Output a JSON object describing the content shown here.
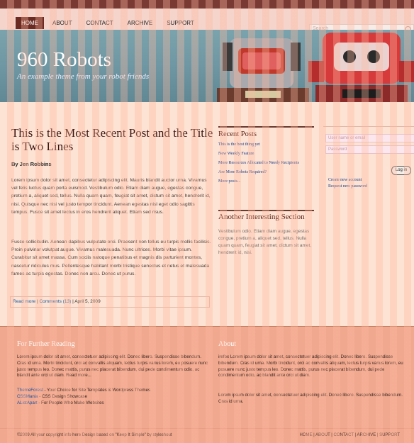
{
  "nav": {
    "items": [
      "HOME",
      "ABOUT",
      "CONTACT",
      "ARCHIVE",
      "SUPPORT"
    ],
    "active": 0,
    "search_placeholder": "Search"
  },
  "banner": {
    "title": "960 Robots",
    "subtitle": "An example theme from your robot friends"
  },
  "post": {
    "title": "This is the Most Recent Post and the Title is Two Lines",
    "byline": "By Jen Robbins",
    "para1": "Lorem ipsum dolor sit amet, consectetur adipiscing elit. Mauris blandit auctor urna. Vivamus vel felis luctus quam porta euismod. Vestibulum odio. Etiam diam augue, egestas congue, pretium a, aliquet sed, tellus. Nulla quam quam, feugiat sit amet, dictum sit amet, hendrerit id, nisi. Quisque nec nisi vel justo tempor tincidunt. Aenean egestas nisl eget odio sagittis tempus. Fusce sit amet lectus in eros hendrerit aliquet. Etiam sed risus.",
    "para2": "Fusce sollicitudin. Aenean dapibus vulputate orci. Praesent non tellus eu turpis mollis facilisis. Proin pulvinar volutpat augue. Vivamus malesuada. Nunc ultrices. Morbi vitae ipsum. Curabitur sit amet massa. Cum sociis natoque penatibus et magnis dis parturient montes, nascetur ridiculus mus. Pellentesque habitant morbi tristique senectus et netus et malesuada fames ac turpis egestas. Donec non arcu. Donec ut purus.",
    "read_more": "Read more",
    "comments": "Comments (13)",
    "date": "April 5, 2009"
  },
  "recent": {
    "heading": "Recent Posts",
    "items": [
      "This is the best thing yet",
      "New Weekly Feature",
      "More Resources Allocated to Needy Recipients",
      "Are More Robots Required?",
      "More posts..."
    ]
  },
  "interest": {
    "heading": "Another Interesting Section",
    "text": "Vestibulum odio. Etiam diam augue, egestas congue, pretium a, aliquet sed, tellus. Nulla quam quam, feugiat sit amet, dictum sit amet, hendrerit id, nisi."
  },
  "login": {
    "user_placeholder": "User name or email",
    "pass_placeholder": "Password",
    "button": "Log in",
    "create": "Create new account",
    "request": "Request new password"
  },
  "footer": {
    "left_heading": "For Further Reading",
    "left_text": "Lorem ipsum dolor sit amet, consectetuer adipiscing elit. Donec libero. Suspendisse bibendum. Cras id urna. Morbi tincidunt, orci ac convallis aliquam, lectus turpis varius lorem, eu posuere nunc justo tempus leo. Donec mattis, purus nec placerat bibendum, dui pede condimentum odio, ac blandit ante orci ut diam. Read more...",
    "links": [
      {
        "name": "ThemeForest",
        "desc": " - Your Choice for Site Templates & Wordpress Themes"
      },
      {
        "name": "CSSMania",
        "desc": " - CSS Design Showcase"
      },
      {
        "name": "AListApart",
        "desc": " - For People Who Make Websites"
      }
    ],
    "right_heading": "About",
    "right_text1": "irefox Lorem ipsum dolor sit amet, consectetuer adipiscing elit. Donec libero. Suspendisse bibendum. Cras id urna. Morbi tincidunt, orci ac convallis aliquam, lectus turpis varius lorem, eu posuere nunc justo tempus leo. Donec mattis, purus nec placerat bibendum, dui pede condimentum odio, ac blandit ante orci ut diam.",
    "right_text2": "Lorem ipsum dolor sit amet, consectetuer adipiscing elit. Donec libero. Suspendisse bibendum. Cras id urna.",
    "copyright": "©2009 All your copyright info here    Design based on \"Keep It Simple\" by styleshout",
    "bottom_links": "HOME | ABOUT | CONTACT | ARCHIVE | SUPPORT"
  }
}
